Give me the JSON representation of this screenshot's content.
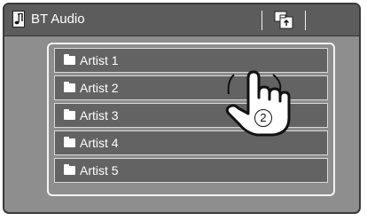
{
  "header": {
    "title": "BT Audio",
    "source_icon": "music-note-icon",
    "folder_button_icon": "folder-up-icon"
  },
  "list": {
    "items": [
      {
        "label": "Artist 1",
        "icon": "folder-icon"
      },
      {
        "label": "Artist 2",
        "icon": "folder-icon"
      },
      {
        "label": "Artist 3",
        "icon": "folder-icon"
      },
      {
        "label": "Artist 4",
        "icon": "folder-icon"
      },
      {
        "label": "Artist 5",
        "icon": "folder-icon"
      }
    ]
  },
  "annotation": {
    "step": "2",
    "gesture_icon": "pointing-hand-icon"
  },
  "colors": {
    "background": "#8e8e8e",
    "header": "#5c5c5c",
    "item": "#636363",
    "text": "#ffffff"
  }
}
